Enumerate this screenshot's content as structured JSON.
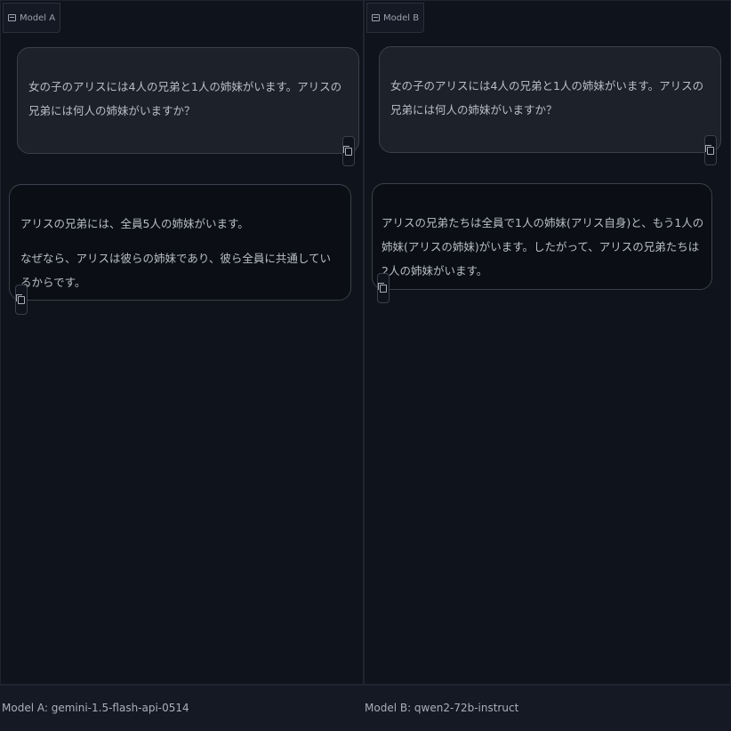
{
  "panels": {
    "a": {
      "tag": "Model A",
      "user_message": "女の子のアリスには4人の兄弟と1人の姉妹がいます。アリスの兄弟には何人の姉妹がいますか？",
      "response": [
        "アリスの兄弟には、全員5人の姉妹がいます。",
        "なぜなら、アリスは彼らの姉妹であり、彼ら全員に共通しているからです。"
      ]
    },
    "b": {
      "tag": "Model B",
      "user_message": "女の子のアリスには4人の兄弟と1人の姉妹がいます。アリスの兄弟には何人の姉妹がいますか？",
      "response": [
        "アリスの兄弟たちは全員で1人の姉妹(アリス自身)と、もう1人の姉妹(アリスの姉妹)がいます。したがって、アリスの兄弟たちは2人の姉妹がいます。"
      ]
    }
  },
  "footer": {
    "model_a": "Model A: gemini-1.5-flash-api-0514",
    "model_b": "Model B: qwen2-72b-instruct"
  },
  "icons": {
    "tag": "chat-icon",
    "copy": "copy-icon"
  }
}
